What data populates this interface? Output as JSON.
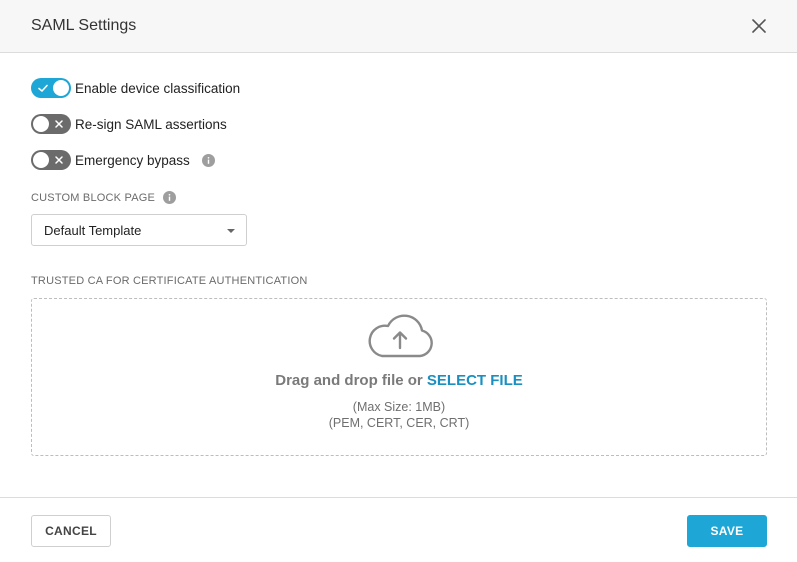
{
  "header": {
    "title": "SAML Settings",
    "close_icon": "close-icon"
  },
  "toggles": [
    {
      "label": "Enable device classification",
      "state": "on"
    },
    {
      "label": "Re-sign SAML assertions",
      "state": "off"
    },
    {
      "label": "Emergency bypass",
      "state": "off",
      "has_info": true
    }
  ],
  "custom_block_page": {
    "label": "CUSTOM BLOCK PAGE",
    "selected": "Default Template"
  },
  "trusted_ca": {
    "label": "TRUSTED CA FOR CERTIFICATE AUTHENTICATION",
    "drag_text": "Drag and drop file or ",
    "select_file": "SELECT FILE",
    "max_size": "(Max Size: 1MB)",
    "formats": "(PEM, CERT, CER, CRT)"
  },
  "footer": {
    "cancel_label": "CANCEL",
    "save_label": "SAVE"
  },
  "colors": {
    "accent": "#1ea6d6",
    "toggle_off": "#6b6b6b",
    "link": "#1a8fc0"
  }
}
